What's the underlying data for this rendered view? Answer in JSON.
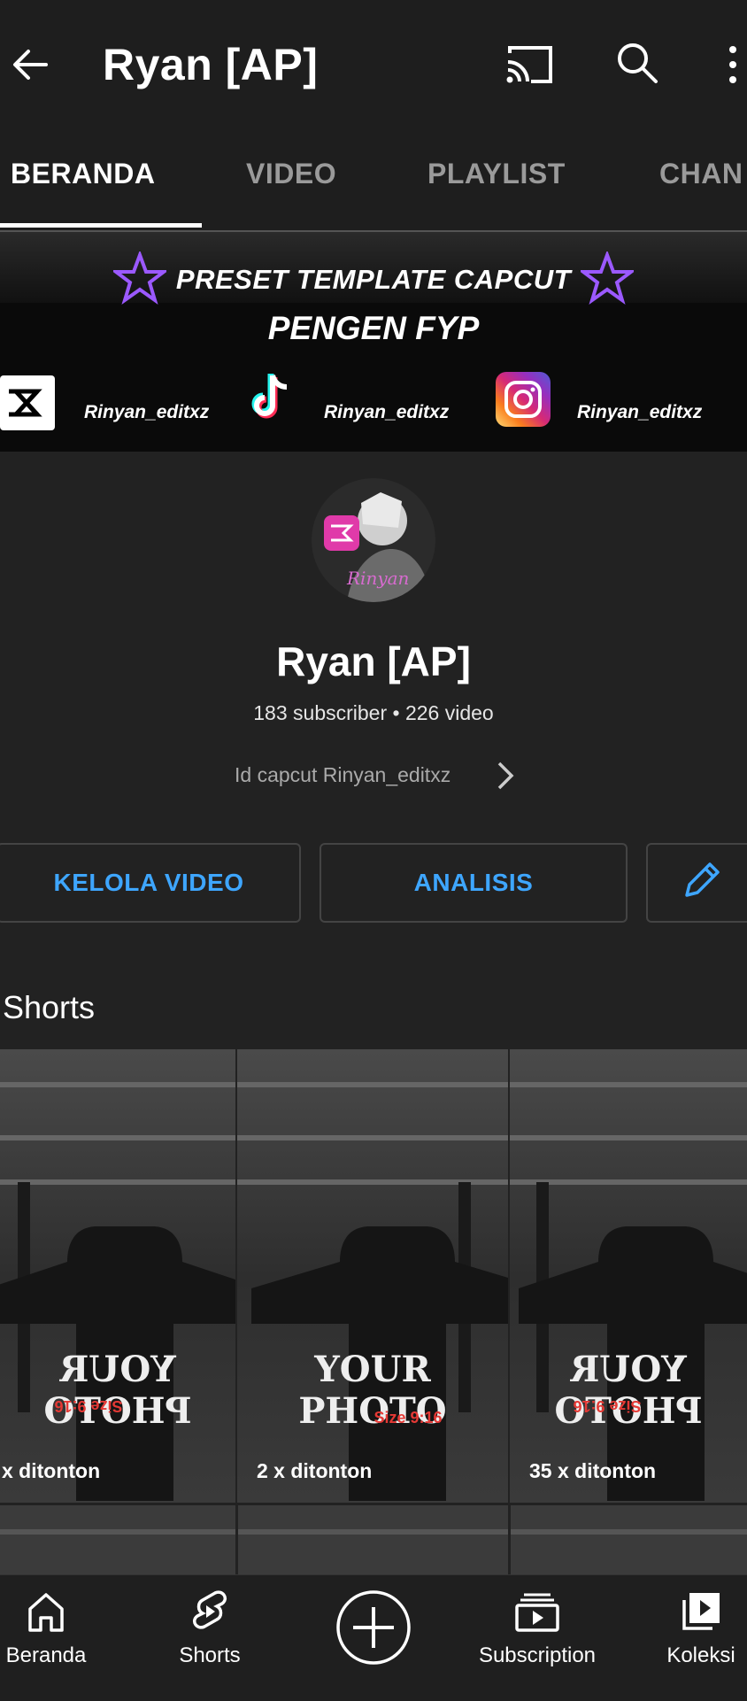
{
  "header": {
    "title": "Ryan [AP]",
    "back_icon": "arrow-left-icon",
    "cast_icon": "cast-icon",
    "search_icon": "search-icon",
    "more_icon": "more-vertical-icon"
  },
  "tabs": [
    {
      "label": "BERANDA",
      "active": true
    },
    {
      "label": "VIDEO",
      "active": false
    },
    {
      "label": "PLAYLIST",
      "active": false
    },
    {
      "label": "CHAN",
      "active": false
    }
  ],
  "banner": {
    "line1": "PRESET TEMPLATE CAPCUT",
    "line2": "PENGEN FYP",
    "handles": [
      "Rinyan_editxz",
      "Rinyan_editxz",
      "Rinyan_editxz"
    ]
  },
  "channel": {
    "name": "Ryan [AP]",
    "stats": "183 subscriber • 226 video",
    "description": "Id capcut Rinyan_editxz"
  },
  "actions": {
    "manage_videos": "KELOLA VIDEO",
    "analytics": "ANALISIS",
    "edit_icon": "pencil-icon"
  },
  "shorts": {
    "heading": "Shorts",
    "items": [
      {
        "views": "x ditonton",
        "text": "YOUR PHOTO",
        "size": "Size 9:16"
      },
      {
        "views": "2 x ditonton",
        "text": "YOUR PHOTO",
        "size": "Size 9:16"
      },
      {
        "views": "35 x ditonton",
        "text": "YOUR PHOTO",
        "size": "Size 9:16"
      }
    ]
  },
  "bottom_nav": [
    {
      "label": "Beranda",
      "icon": "home-icon"
    },
    {
      "label": "Shorts",
      "icon": "shorts-icon"
    },
    {
      "label": "",
      "icon": "create-plus-icon"
    },
    {
      "label": "Subscription",
      "icon": "subscriptions-icon"
    },
    {
      "label": "Koleksi",
      "icon": "library-icon"
    }
  ],
  "colors": {
    "background": "#222222",
    "accent_blue": "#3ea6ff",
    "tab_inactive": "#9a9a9a"
  }
}
